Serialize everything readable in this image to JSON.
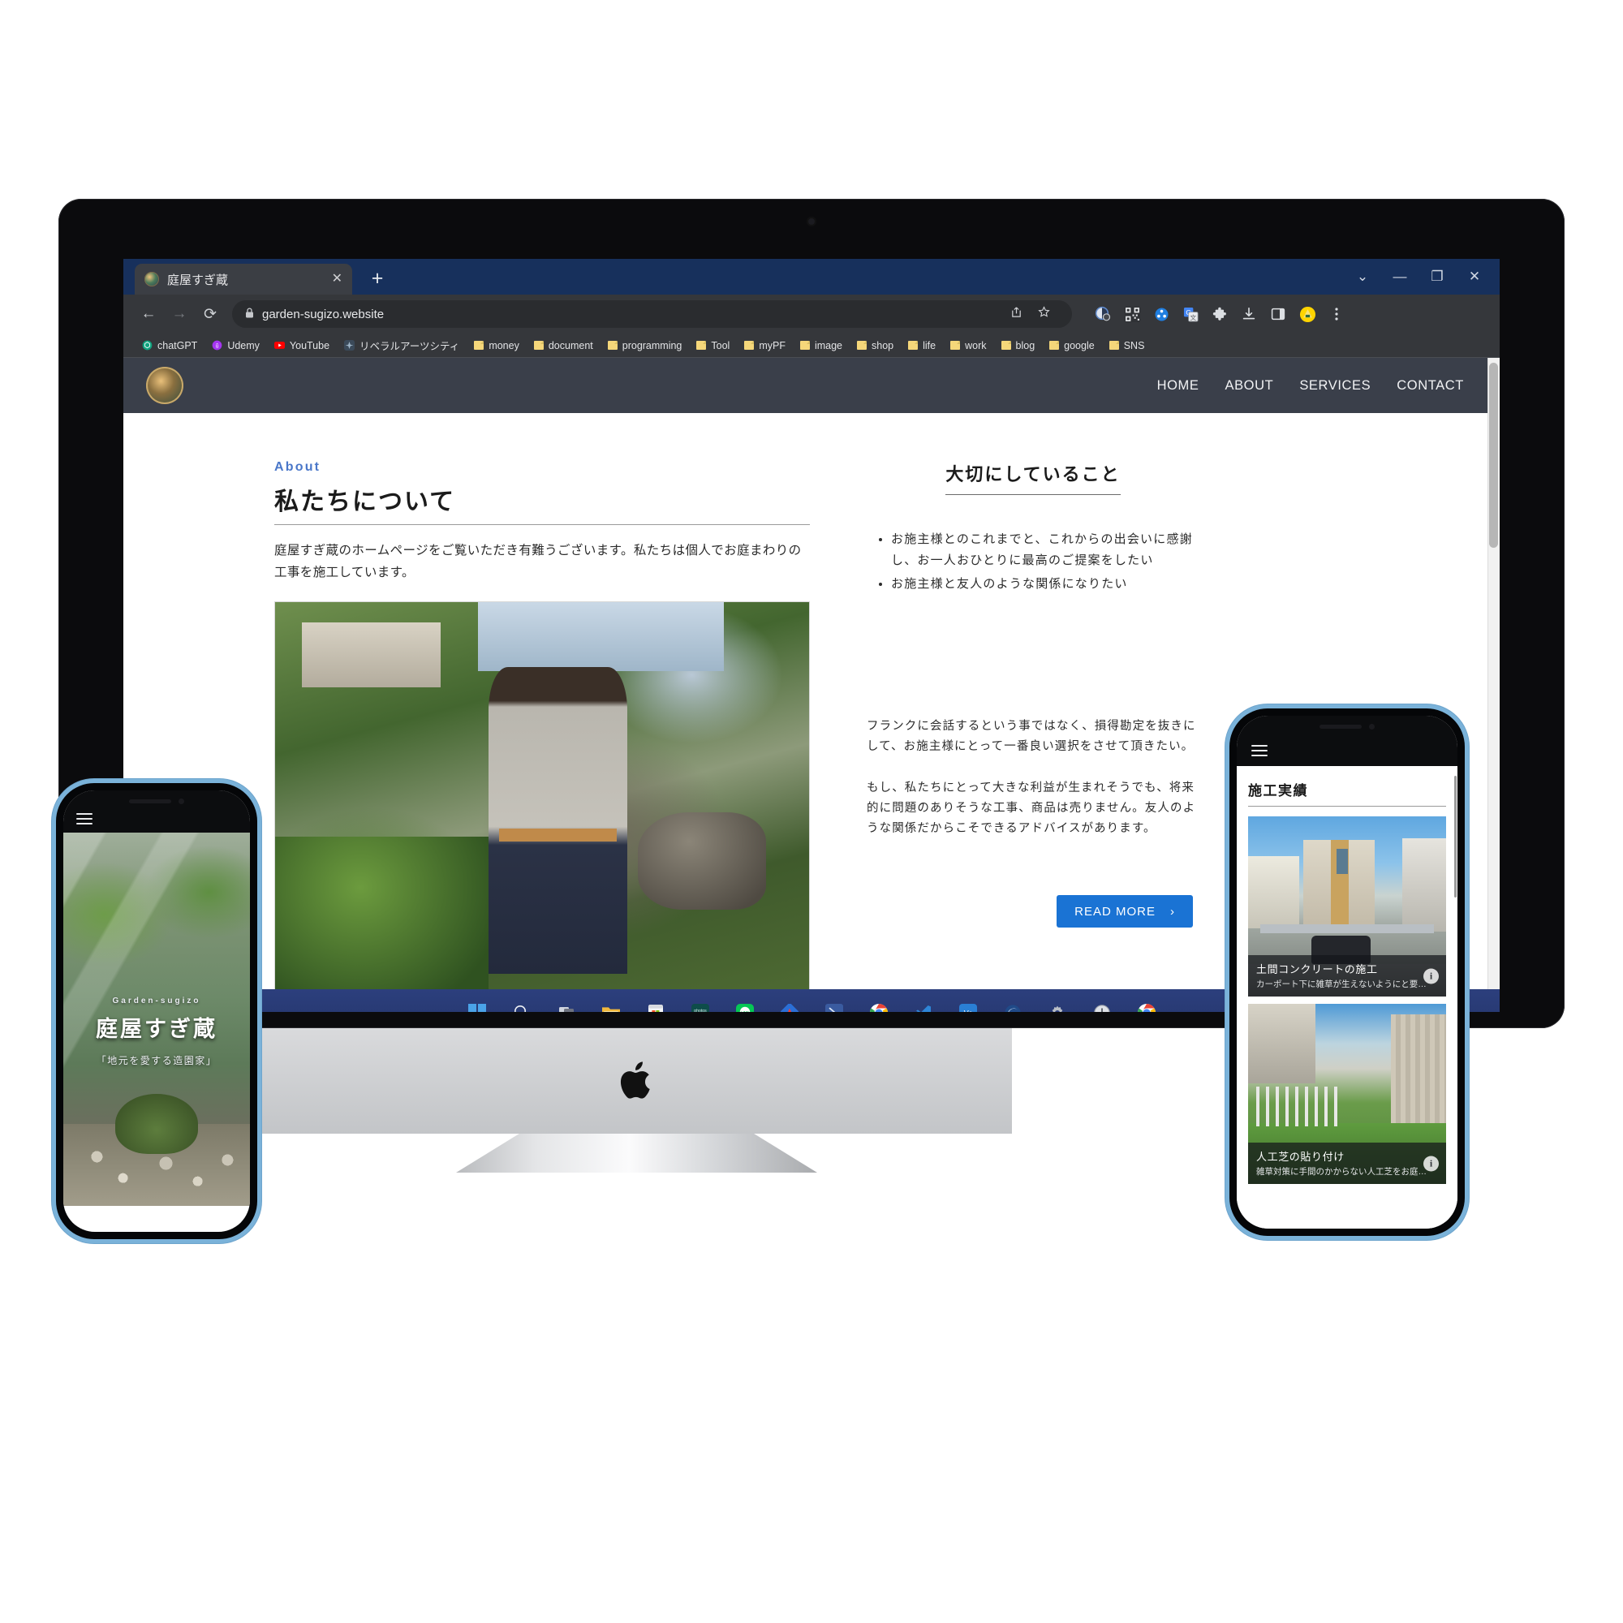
{
  "browser": {
    "tab": {
      "title": "庭屋すぎ蔵",
      "close_label": "✕",
      "favicon": "site-favicon"
    },
    "new_tab_label": "+",
    "window_controls": {
      "minimize": "—",
      "maximize": "❐",
      "close": "✕",
      "more": "⌄"
    },
    "nav": {
      "back": "←",
      "forward": "→",
      "reload": "⟳"
    },
    "omnibox": {
      "lock_icon": "🔒",
      "url": "garden-sugizo.website",
      "share_icon": "⤴",
      "bookmark_icon": "☆"
    },
    "toolbar_icons": [
      "profile-badge-icon",
      "qr-code-icon",
      "puzzle-blue-icon",
      "google-translate-icon",
      "extensions-puzzle-icon",
      "download-icon",
      "side-panel-icon",
      "keeper-icon",
      "chrome-menu-icon"
    ],
    "bookmarks": [
      {
        "label": "chatGPT",
        "icon": "chatgpt-icon",
        "color": "#10a37f"
      },
      {
        "label": "Udemy",
        "icon": "udemy-icon",
        "color": "#a435f0"
      },
      {
        "label": "YouTube",
        "icon": "youtube-icon",
        "color": "#ff0000"
      },
      {
        "label": "リベラルアーツシティ",
        "icon": "liberal-arts-icon",
        "color": "#3b4a5a"
      },
      {
        "label": "money",
        "icon": "folder-icon",
        "color": "#f5d77a"
      },
      {
        "label": "document",
        "icon": "folder-icon",
        "color": "#f5d77a"
      },
      {
        "label": "programming",
        "icon": "folder-icon",
        "color": "#f5d77a"
      },
      {
        "label": "Tool",
        "icon": "folder-icon",
        "color": "#f5d77a"
      },
      {
        "label": "myPF",
        "icon": "folder-icon",
        "color": "#f5d77a"
      },
      {
        "label": "image",
        "icon": "folder-icon",
        "color": "#f5d77a"
      },
      {
        "label": "shop",
        "icon": "folder-icon",
        "color": "#f5d77a"
      },
      {
        "label": "life",
        "icon": "folder-icon",
        "color": "#f5d77a"
      },
      {
        "label": "work",
        "icon": "folder-icon",
        "color": "#f5d77a"
      },
      {
        "label": "blog",
        "icon": "folder-icon",
        "color": "#f5d77a"
      },
      {
        "label": "google",
        "icon": "folder-icon",
        "color": "#f5d77a"
      },
      {
        "label": "SNS",
        "icon": "folder-icon",
        "color": "#f5d77a"
      }
    ]
  },
  "site": {
    "logo_alt": "庭屋すぎ蔵 logo",
    "nav": [
      {
        "label": "HOME"
      },
      {
        "label": "ABOUT"
      },
      {
        "label": "SERVICES"
      },
      {
        "label": "CONTACT"
      }
    ],
    "about": {
      "eyebrow": "About",
      "heading": "私たちについて",
      "lead": "庭屋すぎ蔵のホームページをご覧いただき有難うございます。私たちは個人でお庭まわりの工事を施工しています。",
      "photo_alt": "庭で剪定作業をするスタッフの写真"
    },
    "values": {
      "heading": "大切にしていること",
      "bullets": [
        "お施主様とのこれまでと、これからの出会いに感謝し、お一人おひとりに最高のご提案をしたい",
        "お施主様と友人のような関係になりたい"
      ],
      "paragraphs": [
        "フランクに会話するという事ではなく、損得勘定を抜きにして、お施主様にとって一番良い選択をさせて頂きたい。",
        "もし、私たちにとって大きな利益が生まれそうでも、将来的に問題のありそうな工事、商品は売りません。友人のような関係だからこそできるアドバイスがあります。"
      ]
    },
    "read_more": {
      "label": "READ MORE",
      "chevron": "›"
    },
    "accent_color": "#1a73d4",
    "header_bg": "#3a3f4a"
  },
  "taskbar": {
    "items": [
      {
        "name": "start-icon",
        "label": ""
      },
      {
        "name": "search-icon",
        "label": ""
      },
      {
        "name": "task-view-icon",
        "label": ""
      },
      {
        "name": "file-explorer-icon",
        "label": ""
      },
      {
        "name": "microsoft-store-icon",
        "label": ""
      },
      {
        "name": "photos-icon",
        "label": "photos"
      },
      {
        "name": "line-icon",
        "label": "LINE"
      },
      {
        "name": "adobe-icon",
        "label": ""
      },
      {
        "name": "powershell-icon",
        "label": ""
      },
      {
        "name": "chrome-icon",
        "label": ""
      },
      {
        "name": "vscode-icon",
        "label": ""
      },
      {
        "name": "vnc-icon",
        "label": "VNC"
      },
      {
        "name": "edge-dev-icon",
        "label": ""
      },
      {
        "name": "settings-icon",
        "label": ""
      },
      {
        "name": "clock-icon",
        "label": ""
      },
      {
        "name": "chrome-canary-icon",
        "label": ""
      }
    ]
  },
  "phone_left": {
    "menu_icon": "hamburger-icon",
    "hero": {
      "brand_small": "Garden-sugizo",
      "brand_big": "庭屋すぎ蔵",
      "tagline": "「地元を愛する造園家」"
    }
  },
  "phone_right": {
    "menu_icon": "hamburger-icon",
    "heading": "施工実績",
    "cards": [
      {
        "title": "土間コンクリートの施工",
        "subtitle": "カーポート下に雑草が生えないようにと要…",
        "info_label": "i"
      },
      {
        "title": "人工芝の貼り付け",
        "subtitle": "雑草対策に手間のかからない人工芝をお庭…",
        "info_label": "i"
      }
    ]
  },
  "device": {
    "apple_logo": "apple-logo"
  }
}
